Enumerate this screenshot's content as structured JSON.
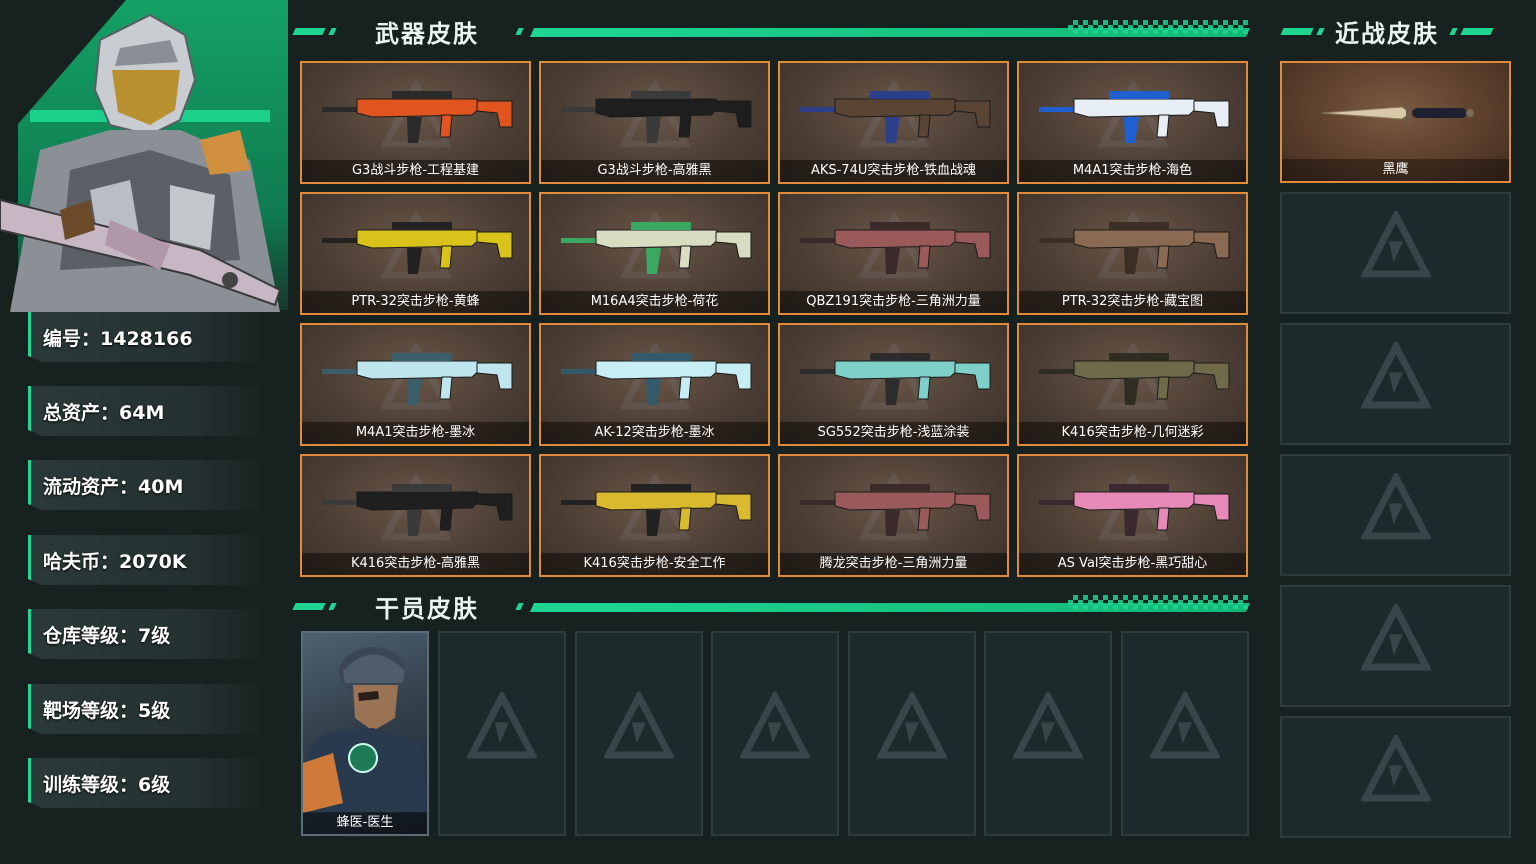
{
  "player": {
    "stats": [
      {
        "label": "编号：1428166"
      },
      {
        "label": "总资产：64M"
      },
      {
        "label": "流动资产：40M"
      },
      {
        "label": "哈夫币：2070K"
      },
      {
        "label": "仓库等级：7级"
      },
      {
        "label": "靶场等级：5级"
      },
      {
        "label": "训练等级：6级"
      }
    ]
  },
  "sections": {
    "weapon_title": "武器皮肤",
    "operator_title": "干员皮肤",
    "melee_title": "近战皮肤"
  },
  "weapons": [
    {
      "name": "G3战斗步枪-工程基建",
      "color": "#e0551f",
      "accent": "#2a2a2a"
    },
    {
      "name": "G3战斗步枪-高雅黑",
      "color": "#1e1e1e",
      "accent": "#3a3a3a"
    },
    {
      "name": "AKS-74U突击步枪-铁血战魂",
      "color": "#5a4535",
      "accent": "#2b3f8a"
    },
    {
      "name": "M4A1突击步枪-海色",
      "color": "#e8eef5",
      "accent": "#1f5fd0"
    },
    {
      "name": "PTR-32突击步枪-黄蜂",
      "color": "#d9c21a",
      "accent": "#222222"
    },
    {
      "name": "M16A4突击步枪-荷花",
      "color": "#d8dcc0",
      "accent": "#3aa860"
    },
    {
      "name": "QBZ191突击步枪-三角洲力量",
      "color": "#9a5a5a",
      "accent": "#3a2a2a"
    },
    {
      "name": "PTR-32突击步枪-藏宝图",
      "color": "#8a6a52",
      "accent": "#3b2e25"
    },
    {
      "name": "M4A1突击步枪-墨冰",
      "color": "#bfe6ef",
      "accent": "#3c5d6a"
    },
    {
      "name": "AK-12突击步枪-墨冰",
      "color": "#c7eef4",
      "accent": "#34596a"
    },
    {
      "name": "SG552突击步枪-浅蓝涂装",
      "color": "#7fd0c8",
      "accent": "#2c2c2c"
    },
    {
      "name": "K416突击步枪-几何迷彩",
      "color": "#6f6a4a",
      "accent": "#2f2d22"
    },
    {
      "name": "K416突击步枪-高雅黑",
      "color": "#1f1f1f",
      "accent": "#3a3a3a"
    },
    {
      "name": "K416突击步枪-安全工作",
      "color": "#d9b92e",
      "accent": "#222222"
    },
    {
      "name": "腾龙突击步枪-三角洲力量",
      "color": "#9a5a5a",
      "accent": "#3a2a2a"
    },
    {
      "name": "AS Val突击步枪-黑巧甜心",
      "color": "#e88ab8",
      "accent": "#3a2a30"
    }
  ],
  "operators": [
    {
      "name": "蜂医-医生"
    }
  ],
  "melee": [
    {
      "name": "黑鹰"
    }
  ],
  "colors": {
    "accent_green": "#1fd592",
    "card_border": "#e08a3a",
    "background": "#17211f"
  }
}
